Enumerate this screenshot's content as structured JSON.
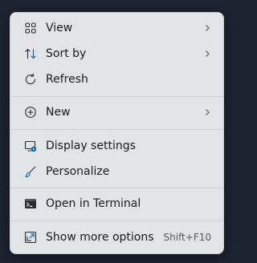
{
  "menu": {
    "items": [
      {
        "label": "View",
        "icon": "grid-icon",
        "submenu": true
      },
      {
        "label": "Sort by",
        "icon": "sort-icon",
        "submenu": true
      },
      {
        "label": "Refresh",
        "icon": "refresh-icon",
        "submenu": false
      },
      {
        "label": "New",
        "icon": "plus-circle-icon",
        "submenu": true
      },
      {
        "label": "Display settings",
        "icon": "display-settings-icon",
        "submenu": false
      },
      {
        "label": "Personalize",
        "icon": "brush-icon",
        "submenu": false
      },
      {
        "label": "Open in Terminal",
        "icon": "terminal-icon",
        "submenu": false
      },
      {
        "label": "Show more options",
        "icon": "show-more-icon",
        "shortcut": "Shift+F10",
        "submenu": false
      }
    ]
  },
  "colors": {
    "menu_background": "#e3e4e8",
    "desktop_background": "#1c2331",
    "accent": "#0067c0",
    "text": "#1b1b1b"
  }
}
